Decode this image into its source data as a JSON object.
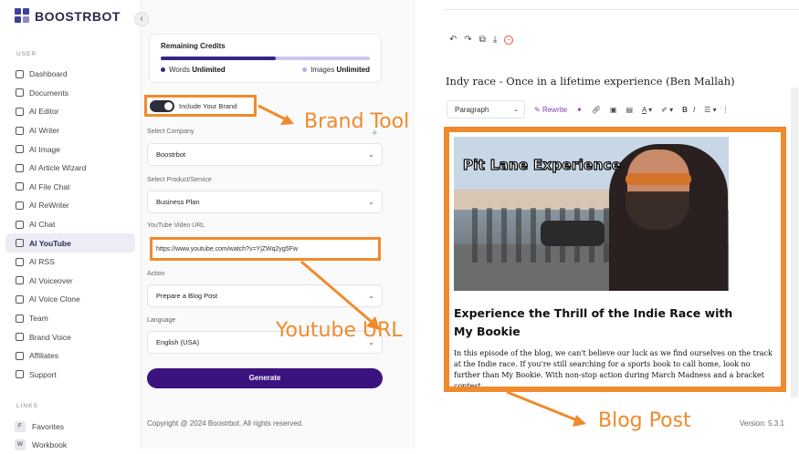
{
  "brand": {
    "name": "BOOSTRBOT"
  },
  "sidebar": {
    "user_label": "USER",
    "items": [
      {
        "label": "Dashboard",
        "icon": "grid-icon"
      },
      {
        "label": "Documents",
        "icon": "document-icon"
      },
      {
        "label": "AI Editor",
        "icon": "editor-icon"
      },
      {
        "label": "AI Writer",
        "icon": "writer-icon"
      },
      {
        "label": "AI Image",
        "icon": "image-icon"
      },
      {
        "label": "AI Article Wizard",
        "icon": "wizard-icon"
      },
      {
        "label": "AI File Chat",
        "icon": "file-chat-icon"
      },
      {
        "label": "AI ReWriter",
        "icon": "rewriter-icon"
      },
      {
        "label": "AI Chat",
        "icon": "chat-icon"
      },
      {
        "label": "AI YouTube",
        "icon": "youtube-icon",
        "active": true
      },
      {
        "label": "AI RSS",
        "icon": "rss-icon"
      },
      {
        "label": "AI Voiceover",
        "icon": "voiceover-icon"
      },
      {
        "label": "AI Voice Clone",
        "icon": "voice-clone-icon"
      },
      {
        "label": "Team",
        "icon": "team-icon"
      },
      {
        "label": "Brand Voice",
        "icon": "brand-voice-icon"
      },
      {
        "label": "Affiliates",
        "icon": "affiliates-icon"
      },
      {
        "label": "Support",
        "icon": "support-icon"
      }
    ],
    "links_label": "LINKS",
    "links": [
      {
        "badge": "F",
        "label": "Favorites"
      },
      {
        "badge": "W",
        "label": "Workbook"
      }
    ]
  },
  "credits": {
    "title": "Remaining Credits",
    "words_label": "Words",
    "words_value": "Unlimited",
    "images_label": "Images",
    "images_value": "Unlimited",
    "words_color": "#3a2489",
    "images_color": "#b3adf0"
  },
  "form": {
    "brand_toggle_label": "Include Your Brand",
    "company_label": "Select Company",
    "company_value": "Boostrbot",
    "product_label": "Select Product/Service",
    "product_value": "Business Plan",
    "youtube_label": "YouTube Video URL",
    "youtube_value": "https://www.youtube.com/watch?v=YjZWq2yg5Fw",
    "action_label": "Action",
    "action_value": "Prepare a Blog Post",
    "language_label": "Language",
    "language_value": "English (USA)",
    "generate_label": "Generate"
  },
  "footer": {
    "copyright": "Copyright @ 2024 Boostrbot. All rights reserved.",
    "version": "Version: 5.3.1"
  },
  "editor": {
    "doc_title": "Indy race - Once in a lifetime experience (Ben Mallah)",
    "paragraph_select": "Paragraph",
    "rewrite_label": "Rewrite",
    "photo_caption": "Pit Lane Experience",
    "post_heading": "Experience the Thrill of the Indie Race with My Bookie",
    "post_body": "In this episode of the blog, we can't believe our luck as we find ourselves on the track at the Indie race. If you're still searching for a sports book to call home, look no further than My Bookie. With non-stop action during March Madness and a bracket contest"
  },
  "annotations": {
    "brand_tool": "Brand Tool",
    "youtube_url": "Youtube URL",
    "blog_post": "Blog Post",
    "color": "#f08a2c"
  }
}
